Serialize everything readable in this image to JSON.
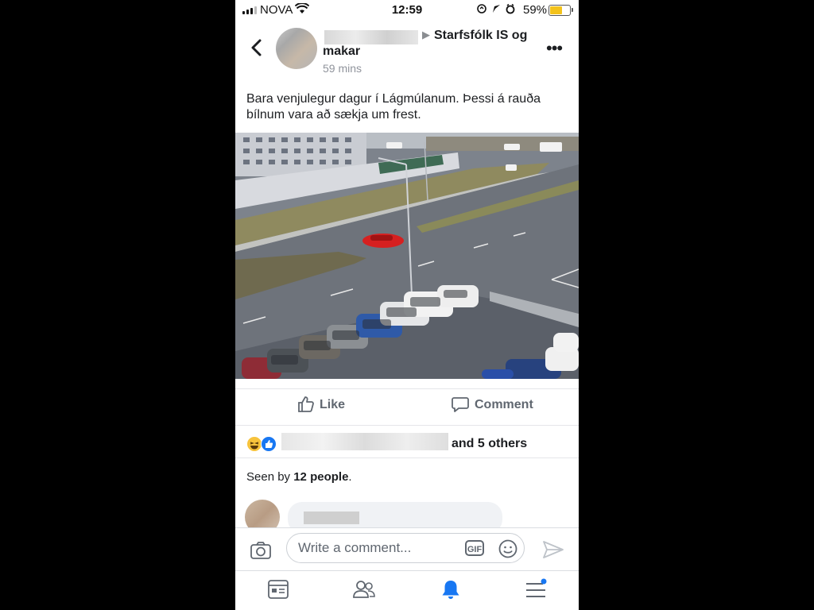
{
  "status_bar": {
    "carrier": "NOVA",
    "time": "12:59",
    "battery_percent": "59%",
    "battery_level": 0.59,
    "battery_color": "#f3c21b"
  },
  "post": {
    "group_name_line1": "Starfsfólk IS og",
    "group_name_line2": "makar",
    "time_ago": "59 mins",
    "text": "Bara venjulegur dagur í Lágmúlanum. Þessi á rauða bílnum vara að sækja um frest.",
    "image_description_icon": "photo"
  },
  "actions": {
    "like_label": "Like",
    "comment_label": "Comment"
  },
  "reactions": {
    "icons": [
      "haha-icon",
      "like-icon"
    ],
    "others_text": "and 5 others"
  },
  "seen": {
    "prefix": "Seen by ",
    "count_text": "12 people",
    "suffix": "."
  },
  "composer": {
    "placeholder": "Write a comment...",
    "gif_label": "GIF"
  },
  "tab_bar": {
    "items": [
      "news-feed-icon",
      "friends-icon",
      "notifications-icon",
      "menu-icon"
    ],
    "active": "notifications-icon"
  },
  "colors": {
    "brand_blue": "#1877f2",
    "text": "#1c1e21",
    "secondary_text": "#606770"
  }
}
